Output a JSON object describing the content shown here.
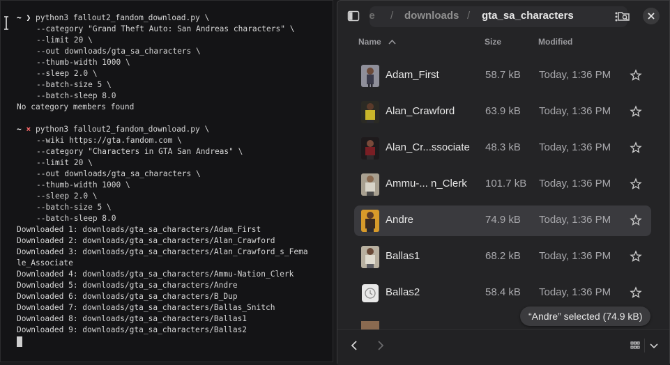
{
  "terminal": {
    "block1": {
      "prompt": "~ ❯",
      "command": "python3 fallout2_fandom_download.py \\",
      "args": [
        "--category \"Grand Theft Auto: San Andreas characters\" \\",
        "--limit 20 \\",
        "--out downloads/gta_sa_characters \\",
        "--thumb-width 1000 \\",
        "--sleep 2.0 \\",
        "--batch-size 5 \\",
        "--batch-sleep 8.0"
      ],
      "output": "No category members found"
    },
    "block2": {
      "prompt_tilde": "~",
      "prompt_mark": "×",
      "command": "python3 fallout2_fandom_download.py \\",
      "args": [
        "--wiki https://gta.fandom.com \\",
        "--category \"Characters in GTA San Andreas\" \\",
        "--limit 20 \\",
        "--out downloads/gta_sa_characters \\",
        "--thumb-width 1000 \\",
        "--sleep 2.0 \\",
        "--batch-size 5 \\",
        "--batch-sleep 8.0"
      ],
      "output": [
        "Downloaded 1: downloads/gta_sa_characters/Adam_First",
        "Downloaded 2: downloads/gta_sa_characters/Alan_Crawford",
        "Downloaded 3: downloads/gta_sa_characters/Alan_Crawford_s_Fema",
        "le_Associate",
        "Downloaded 4: downloads/gta_sa_characters/Ammu-Nation_Clerk",
        "Downloaded 5: downloads/gta_sa_characters/Andre",
        "Downloaded 6: downloads/gta_sa_characters/B_Dup",
        "Downloaded 7: downloads/gta_sa_characters/Ballas_Snitch",
        "Downloaded 8: downloads/gta_sa_characters/Ballas1",
        "Downloaded 9: downloads/gta_sa_characters/Ballas2"
      ]
    }
  },
  "files": {
    "breadcrumb": {
      "home": "me",
      "sep": "/",
      "parent": "downloads",
      "current": "gta_sa_characters"
    },
    "columns": {
      "name": "Name",
      "size": "Size",
      "modified": "Modified"
    },
    "rows": [
      {
        "name": "Adam_First",
        "size": "58.7 kB",
        "modified": "Today, 1:36 PM",
        "thumb": "thumb-adam",
        "selected": false
      },
      {
        "name": "Alan_Crawford",
        "size": "63.9 kB",
        "modified": "Today, 1:36 PM",
        "thumb": "thumb-alan",
        "selected": false
      },
      {
        "name": "Alan_Cr...ssociate",
        "size": "48.3 kB",
        "modified": "Today, 1:36 PM",
        "thumb": "thumb-assoc",
        "selected": false
      },
      {
        "name": "Ammu-...  n_Clerk",
        "size": "101.7 kB",
        "modified": "Today, 1:36 PM",
        "thumb": "thumb-clerk",
        "selected": false
      },
      {
        "name": "Andre",
        "size": "74.9 kB",
        "modified": "Today, 1:36 PM",
        "thumb": "thumb-andre",
        "selected": true
      },
      {
        "name": "Ballas1",
        "size": "68.2 kB",
        "modified": "Today, 1:36 PM",
        "thumb": "thumb-ballas1",
        "selected": false
      },
      {
        "name": "Ballas2",
        "size": "58.4 kB",
        "modified": "Today, 1:36 PM",
        "thumb": "clock-icon",
        "selected": false
      }
    ],
    "status": "“Andre” selected  (74.9 kB)"
  },
  "colors": {
    "terminal_bg": "#141416",
    "files_bg": "#242426",
    "selected_row": "#3a3a3e",
    "prompt_error": "#ff6b6b"
  }
}
